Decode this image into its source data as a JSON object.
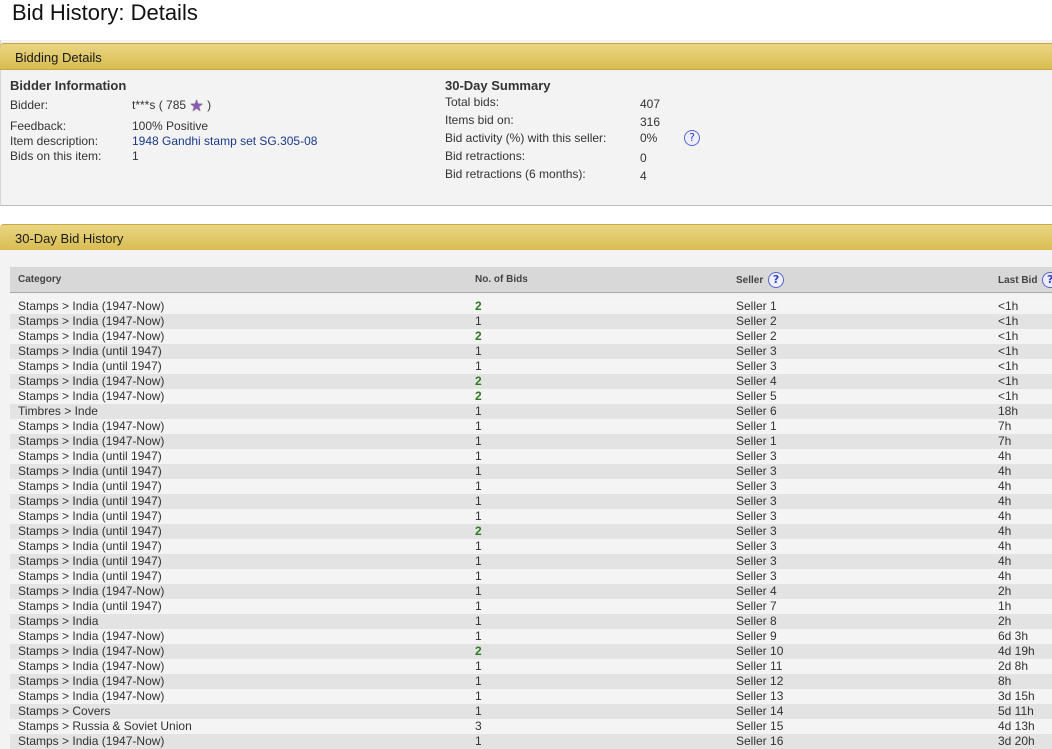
{
  "page_title": "Bid History: Details",
  "bidding_details": {
    "header": "Bidding Details",
    "bidder_info": {
      "heading": "Bidder Information",
      "bidder_label": "Bidder:",
      "bidder_name": "t***s",
      "bidder_score": "( 785",
      "bidder_score_close": ")",
      "feedback_label": "Feedback:",
      "feedback_value": "100% Positive",
      "item_label": "Item description:",
      "item_value": "1948 Gandhi stamp set SG.305-08",
      "bids_label": "Bids on this item:",
      "bids_value": "1"
    },
    "summary": {
      "heading": "30-Day Summary",
      "rows": [
        {
          "label": "Total bids:",
          "value": "407"
        },
        {
          "label": "Items bid on:",
          "value": "316"
        },
        {
          "label": "Bid activity (%) with this seller:",
          "value": "0%"
        },
        {
          "label": "Bid retractions:",
          "value": "0"
        },
        {
          "label": "Bid retractions (6 months):",
          "value": "4"
        }
      ]
    }
  },
  "history": {
    "header": "30-Day Bid History",
    "columns": {
      "category": "Category",
      "bids": "No. of Bids",
      "seller": "Seller",
      "last_bid": "Last Bid"
    },
    "rows": [
      {
        "category": "Stamps > India (1947-Now)",
        "bids": "2",
        "seller": "Seller 1",
        "last": "<1h"
      },
      {
        "category": "Stamps > India (1947-Now)",
        "bids": "1",
        "seller": "Seller 2",
        "last": "<1h"
      },
      {
        "category": "Stamps > India (1947-Now)",
        "bids": "2",
        "seller": "Seller 2",
        "last": "<1h"
      },
      {
        "category": "Stamps > India (until 1947)",
        "bids": "1",
        "seller": "Seller 3",
        "last": "<1h"
      },
      {
        "category": "Stamps > India (until 1947)",
        "bids": "1",
        "seller": "Seller 3",
        "last": "<1h"
      },
      {
        "category": "Stamps > India (1947-Now)",
        "bids": "2",
        "seller": "Seller 4",
        "last": "<1h"
      },
      {
        "category": "Stamps > India (1947-Now)",
        "bids": "2",
        "seller": "Seller 5",
        "last": "<1h"
      },
      {
        "category": "Timbres > Inde",
        "bids": "1",
        "seller": "Seller 6",
        "last": "18h"
      },
      {
        "category": "Stamps > India (1947-Now)",
        "bids": "1",
        "seller": "Seller 1",
        "last": "7h"
      },
      {
        "category": "Stamps > India (1947-Now)",
        "bids": "1",
        "seller": "Seller 1",
        "last": "7h"
      },
      {
        "category": "Stamps > India (until 1947)",
        "bids": "1",
        "seller": "Seller 3",
        "last": "4h"
      },
      {
        "category": "Stamps > India (until 1947)",
        "bids": "1",
        "seller": "Seller 3",
        "last": "4h"
      },
      {
        "category": "Stamps > India (until 1947)",
        "bids": "1",
        "seller": "Seller 3",
        "last": "4h"
      },
      {
        "category": "Stamps > India (until 1947)",
        "bids": "1",
        "seller": "Seller 3",
        "last": "4h"
      },
      {
        "category": "Stamps > India (until 1947)",
        "bids": "1",
        "seller": "Seller 3",
        "last": "4h"
      },
      {
        "category": "Stamps > India (until 1947)",
        "bids": "2",
        "seller": "Seller 3",
        "last": "4h"
      },
      {
        "category": "Stamps > India (until 1947)",
        "bids": "1",
        "seller": "Seller 3",
        "last": "4h"
      },
      {
        "category": "Stamps > India (until 1947)",
        "bids": "1",
        "seller": "Seller 3",
        "last": "4h"
      },
      {
        "category": "Stamps > India (until 1947)",
        "bids": "1",
        "seller": "Seller 3",
        "last": "4h"
      },
      {
        "category": "Stamps > India (1947-Now)",
        "bids": "1",
        "seller": "Seller 4",
        "last": "2h"
      },
      {
        "category": "Stamps > India (until 1947)",
        "bids": "1",
        "seller": "Seller 7",
        "last": "1h"
      },
      {
        "category": "Stamps > India",
        "bids": "1",
        "seller": "Seller 8",
        "last": "2h"
      },
      {
        "category": "Stamps > India (1947-Now)",
        "bids": "1",
        "seller": "Seller 9",
        "last": "6d 3h"
      },
      {
        "category": "Stamps > India (1947-Now)",
        "bids": "2",
        "seller": "Seller 10",
        "last": "4d 19h"
      },
      {
        "category": "Stamps > India (1947-Now)",
        "bids": "1",
        "seller": "Seller 11",
        "last": "2d 8h"
      },
      {
        "category": "Stamps > India (1947-Now)",
        "bids": "1",
        "seller": "Seller 12",
        "last": "8h"
      },
      {
        "category": "Stamps > India (1947-Now)",
        "bids": "1",
        "seller": "Seller 13",
        "last": "3d 15h"
      },
      {
        "category": "Stamps > Covers",
        "bids": "1",
        "seller": "Seller 14",
        "last": "5d 11h"
      },
      {
        "category": "Stamps > Russia & Soviet Union",
        "bids": "3",
        "seller": "Seller 15",
        "last": "4d 13h"
      },
      {
        "category": "Stamps > India (1947-Now)",
        "bids": "1",
        "seller": "Seller 16",
        "last": "3d 20h"
      }
    ]
  },
  "colors": {
    "header_gold": "#d9bd52",
    "highlight_bids": "#2f7a22",
    "link": "#1a3a8a"
  }
}
